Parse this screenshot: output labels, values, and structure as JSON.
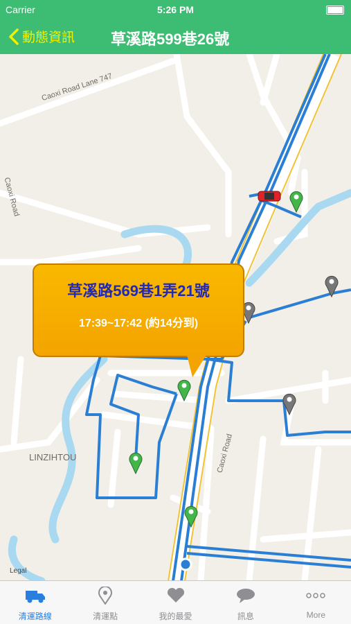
{
  "status": {
    "carrier": "Carrier",
    "time": "5:26 PM"
  },
  "nav": {
    "back_label": "動態資訊",
    "title": "草溪路599巷26號"
  },
  "map": {
    "labels": {
      "lane": "Caoxi Road Lane 747",
      "road_left": "Caoxi Road",
      "road_main": "Caoxi Road",
      "area": "LINZIHTOU"
    },
    "legal": "Legal",
    "callout": {
      "address": "草溪路569巷1弄21號",
      "eta": "17:39~17:42 (約14分到)"
    },
    "pins": [
      {
        "name": "stop-pin",
        "status": "upcoming",
        "color": "#43b64a"
      },
      {
        "name": "stop-pin",
        "status": "passed",
        "color": "#777777"
      }
    ],
    "truck_color": "#e0232a",
    "route_color": "#2a7fd4"
  },
  "tabs": [
    {
      "label": "清運路線",
      "icon": "truck-icon",
      "active": true
    },
    {
      "label": "清運點",
      "icon": "location-pin-icon",
      "active": false
    },
    {
      "label": "我的最愛",
      "icon": "heart-icon",
      "active": false
    },
    {
      "label": "訊息",
      "icon": "speech-bubble-icon",
      "active": false
    },
    {
      "label": "More",
      "icon": "more-dots-icon",
      "active": false
    }
  ]
}
